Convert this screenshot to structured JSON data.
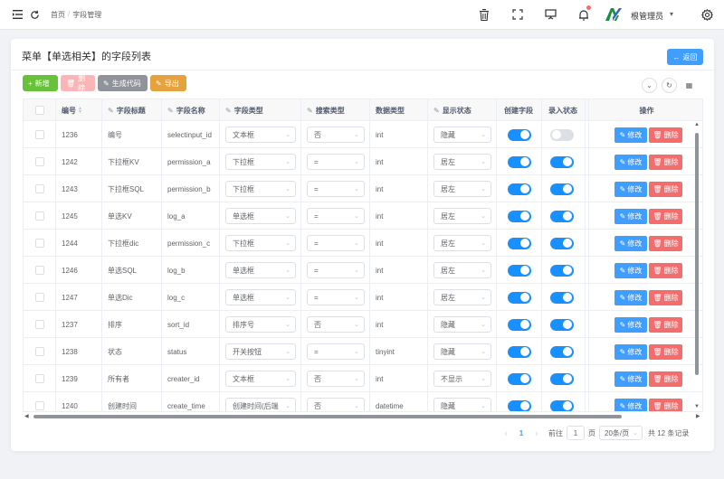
{
  "breadcrumb": {
    "home": "首页",
    "separator": "/",
    "current": "字段管理"
  },
  "user": {
    "name": "根管理员"
  },
  "header_icons": [
    "menu-fold-icon",
    "refresh-icon",
    "trash-icon",
    "fullscreen-icon",
    "monitor-icon",
    "bell-icon",
    "gear-icon"
  ],
  "page": {
    "title": "菜单【单选相关】的字段列表",
    "back_label": "返回"
  },
  "toolbar": {
    "add_label": "新增",
    "delete_label": "删除",
    "gen_label": "生成代码",
    "export_label": "导出"
  },
  "columns": {
    "id": "编号",
    "title": "字段标题",
    "name": "字段名称",
    "field_type": "字段类型",
    "search_type": "搜索类型",
    "data_type": "数据类型",
    "display": "显示状态",
    "create_field": "创建字段",
    "entry_state": "录入状态",
    "action": "操作"
  },
  "actions": {
    "edit_label": "修改",
    "delete_label": "删除"
  },
  "rows": [
    {
      "id": "1236",
      "title": "编号",
      "name": "selectinput_id",
      "field_type": "文本框",
      "search_type": "否",
      "data_type": "int",
      "display": "隐藏",
      "create_field": true,
      "entry_state": false
    },
    {
      "id": "1242",
      "title": "下拉框KV",
      "name": "permission_a",
      "field_type": "下拉框",
      "search_type": "=",
      "data_type": "int",
      "display": "居左",
      "create_field": true,
      "entry_state": true
    },
    {
      "id": "1243",
      "title": "下拉框SQL",
      "name": "permission_b",
      "field_type": "下拉框",
      "search_type": "=",
      "data_type": "int",
      "display": "居左",
      "create_field": true,
      "entry_state": true
    },
    {
      "id": "1245",
      "title": "单选KV",
      "name": "log_a",
      "field_type": "单选框",
      "search_type": "=",
      "data_type": "int",
      "display": "居左",
      "create_field": true,
      "entry_state": true
    },
    {
      "id": "1244",
      "title": "下拉框dic",
      "name": "permission_c",
      "field_type": "下拉框",
      "search_type": "=",
      "data_type": "int",
      "display": "居左",
      "create_field": true,
      "entry_state": true
    },
    {
      "id": "1246",
      "title": "单选SQL",
      "name": "log_b",
      "field_type": "单选框",
      "search_type": "=",
      "data_type": "int",
      "display": "居左",
      "create_field": true,
      "entry_state": true
    },
    {
      "id": "1247",
      "title": "单选Dic",
      "name": "log_c",
      "field_type": "单选框",
      "search_type": "=",
      "data_type": "int",
      "display": "居左",
      "create_field": true,
      "entry_state": true
    },
    {
      "id": "1237",
      "title": "排序",
      "name": "sort_id",
      "field_type": "排序号",
      "search_type": "否",
      "data_type": "int",
      "display": "隐藏",
      "create_field": true,
      "entry_state": true
    },
    {
      "id": "1238",
      "title": "状态",
      "name": "status",
      "field_type": "开关按钮",
      "search_type": "=",
      "data_type": "tinyint",
      "display": "隐藏",
      "create_field": true,
      "entry_state": true
    },
    {
      "id": "1239",
      "title": "所有者",
      "name": "creater_id",
      "field_type": "文本框",
      "search_type": "否",
      "data_type": "int",
      "display": "不显示",
      "create_field": true,
      "entry_state": true
    },
    {
      "id": "1240",
      "title": "创建时间",
      "name": "create_time",
      "field_type": "创建时间(后端",
      "search_type": "否",
      "data_type": "datetime",
      "display": "隐藏",
      "create_field": true,
      "entry_state": true
    }
  ],
  "pagination": {
    "current_page": "1",
    "goto_prefix": "前往",
    "goto_value": "1",
    "goto_suffix": "页",
    "page_size": "20条/页",
    "total_text": "共 12 条记录"
  }
}
